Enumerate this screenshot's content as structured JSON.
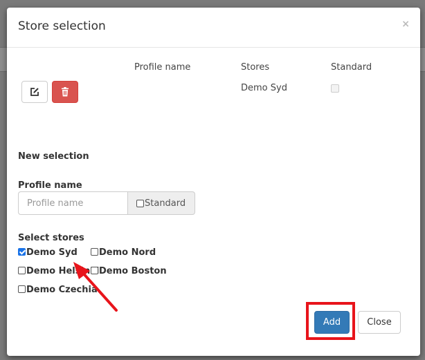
{
  "modal": {
    "title": "Store selection",
    "close_glyph": "×"
  },
  "profiles_table": {
    "headers": {
      "profile_name": "Profile name",
      "stores": "Stores",
      "standard": "Standard"
    },
    "rows": [
      {
        "profile_name": "",
        "stores": "Demo Syd",
        "standard": false
      }
    ]
  },
  "new_selection": {
    "heading": "New selection",
    "profile_name_label": "Profile name",
    "profile_name_value": "",
    "profile_name_placeholder": "Profile name",
    "standard_label": "Standard",
    "standard_checked": false,
    "select_stores_label": "Select stores",
    "stores": [
      {
        "label": "Demo Syd",
        "checked": true
      },
      {
        "label": "Demo Nord",
        "checked": false
      },
      {
        "label": "Demo Helsinki",
        "checked": false
      },
      {
        "label": "Demo Boston",
        "checked": false
      },
      {
        "label": "Demo Czechia",
        "checked": false
      }
    ]
  },
  "footer": {
    "add_label": "Add",
    "close_label": "Close"
  },
  "colors": {
    "primary": "#337ab7",
    "danger": "#d9534f",
    "annotation": "#e8141b"
  },
  "icons": {
    "edit": "edit-icon",
    "delete": "trash-icon"
  }
}
